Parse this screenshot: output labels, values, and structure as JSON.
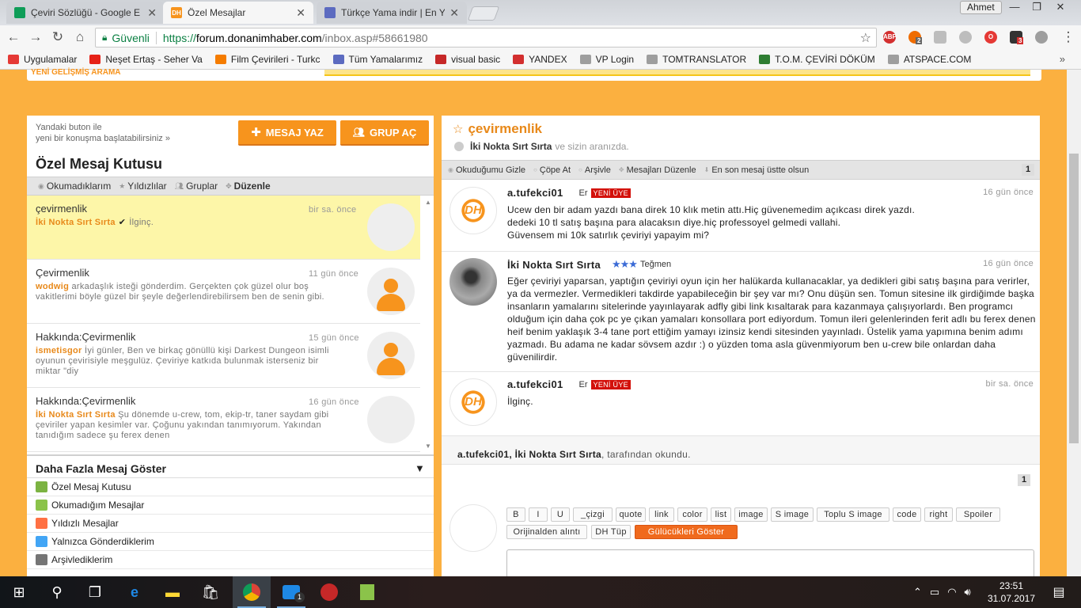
{
  "browser": {
    "tabs": [
      {
        "title": "Çeviri Sözlüğü - Google E",
        "icon": "sheets-icon",
        "active": false
      },
      {
        "title": "Özel Mesajlar",
        "icon": "dh-icon",
        "active": true
      },
      {
        "title": "Türkçe Yama indir | En Ye",
        "icon": "yama-icon",
        "active": false
      }
    ],
    "profile": "Ahmet",
    "secure_label": "Güvenli",
    "url_scheme": "https://",
    "url_host": "forum.donanimhaber.com",
    "url_path": "/inbox.asp#58661980",
    "extension_badges": {
      "ext2": "2",
      "ext3": "3"
    },
    "bookmarks": [
      {
        "label": "Uygulamalar",
        "color": "#e53935"
      },
      {
        "label": "Neşet Ertaş - Seher Va",
        "color": "#e62117"
      },
      {
        "label": "Film Çevirileri - Turkc",
        "color": "#f57c00"
      },
      {
        "label": "Tüm Yamalarımız",
        "color": "#5c6bc0"
      },
      {
        "label": "visual basic",
        "color": "#c62828"
      },
      {
        "label": "YANDEX",
        "color": "#d32f2f"
      },
      {
        "label": "VP Login",
        "color": "#9e9e9e"
      },
      {
        "label": "TOMTRANSLATOR",
        "color": "#9e9e9e"
      },
      {
        "label": "T.O.M. ÇEVİRİ DÖKÜM",
        "color": "#2e7d32"
      },
      {
        "label": "ATSPACE.COM",
        "color": "#9e9e9e"
      }
    ]
  },
  "page": {
    "top_label": "YENİ GELİŞMİŞ ARAMA",
    "left": {
      "hint": "Yandaki buton ile\nyeni bir konuşma başlatabilirsiniz »",
      "compose_label": "MESAJ YAZ",
      "group_label": "GRUP AÇ",
      "box_title": "Özel Mesaj Kutusu",
      "filters": [
        "Okumadıklarım",
        "Yıldızlılar",
        "Gruplar",
        "Düzenle"
      ],
      "conversations": [
        {
          "subject": "çevirmenlik",
          "time": "bir sa. önce",
          "author": "İki Nokta Sırt Sırta",
          "check": "✔",
          "snippet": "İlginç.",
          "avatar": "photo"
        },
        {
          "subject": "Çevirmenlik",
          "time": "11 gün önce",
          "author": "wodwig",
          "check": "",
          "snippet": "arkadaşlık isteği gönderdim. Gerçekten çok güzel olur boş vakitlerimi böyle güzel bir şeyle değerlendirebilirsem ben de senin gibi.",
          "avatar": "person"
        },
        {
          "subject": "Hakkında:Çevirmenlik",
          "time": "15 gün önce",
          "author": "ismetisgor",
          "check": "",
          "snippet": "İyi günler, Ben ve birkaç gönüllü kişi Darkest Dungeon isimli oyunun çevirisiyle meşgulüz. Çeviriye katkıda bulunmak isterseniz bir miktar \"diy",
          "avatar": "person"
        },
        {
          "subject": "Hakkında:Çevirmenlik",
          "time": "16 gün önce",
          "author": "İki Nokta Sırt Sırta",
          "check": "",
          "snippet": "Şu dönemde u-crew, tom, ekip-tr, taner saydam gibi çeviriler yapan kesimler var. Çoğunu yakından tanımıyorum. Yakından tanıdığım sadece şu ferex denen",
          "avatar": "photo"
        }
      ],
      "more_label": "Daha Fazla Mesaj Göster",
      "links": [
        {
          "label": "Özel Mesaj Kutusu",
          "color": "#7cb342"
        },
        {
          "label": "Okumadığım Mesajlar",
          "color": "#8bc34a"
        },
        {
          "label": "Yıldızlı Mesajlar",
          "color": "#ff7043"
        },
        {
          "label": "Yalnızca Gönderdiklerim",
          "color": "#42a5f5"
        },
        {
          "label": "Arşivlediklerim",
          "color": "#757575"
        }
      ]
    },
    "right": {
      "title": "çevirmenlik",
      "participant": "İki Nokta Sırt Sırta",
      "participant_suffix": "ve sizin aranızda.",
      "actions": [
        "Okuduğumu Gizle",
        "Çöpe At",
        "Arşivle",
        "Mesajları Düzenle",
        "En son mesaj üstte olsun"
      ],
      "page_num": "1",
      "messages": [
        {
          "author": "a.tufekci01",
          "rank": "Er",
          "badge": "YENİ ÜYE",
          "stars": "",
          "time": "16 gün önce",
          "avatar": "DH",
          "body": "Ucew den bir adam yazdı bana direk 10 klık metin attı.Hiç güvenemedim açıkcası direk yazdı.\ndedeki 10 tl satış başına para alacaksın diye.hiç professoyel gelmedi vallahi.\nGüvensem mi 10k satırlık çeviriyi yapayim mi?"
        },
        {
          "author": "İki Nokta Sırt Sırta",
          "rank": "Teğmen",
          "badge": "",
          "stars": "★★★",
          "time": "16 gün önce",
          "avatar": "photo",
          "body": "Eğer çeviriyi yaparsan, yaptığın çeviriyi oyun için her halükarda kullanacaklar, ya dedikleri gibi satış başına para verirler, ya da vermezler. Vermedikleri takdirde yapabileceğin bir şey var mı? Onu düşün sen. Tomun sitesine ilk girdiğimde başka insanların yamalarını sitelerinde yayınlayarak adfly gibi link kısaltarak para kazanmaya çalışıyorlardı. Ben programcı olduğum için daha çok pc ye çıkan yamaları konsollara port ediyordum. Tomun ileri gelenlerinden ferit adlı bu ferex denen heif benim yaklaşık 3-4 tane port ettiğim yamayı izinsiz kendi sitesinden yayınladı. Üstelik yama yapımına benim adımı yazmadı. Bu adama ne kadar sövsem azdır :) o yüzden toma asla güvenmiyorum ben u-crew bile onlardan daha güvenilirdir."
        },
        {
          "author": "a.tufekci01",
          "rank": "Er",
          "badge": "YENİ ÜYE",
          "stars": "",
          "time": "bir sa. önce",
          "avatar": "DH",
          "body": "İlginç."
        }
      ],
      "read_by_names": "a.tufekci01, İki Nokta Sırt Sırta",
      "read_by_suffix": ", tarafından okundu.",
      "toolbar_row1": [
        "B",
        "I",
        "U",
        "_çizgi",
        "quote",
        "link",
        "color",
        "list",
        "image",
        "S image",
        "Toplu S image",
        "code",
        "right",
        "Spoiler"
      ],
      "toolbar_row2": [
        "Orijinalden alıntı",
        "DH Tüp",
        "Gülücükleri Göster"
      ]
    }
  },
  "taskbar": {
    "time": "23:51",
    "date": "31.07.2017",
    "messenger_badge": "1"
  }
}
